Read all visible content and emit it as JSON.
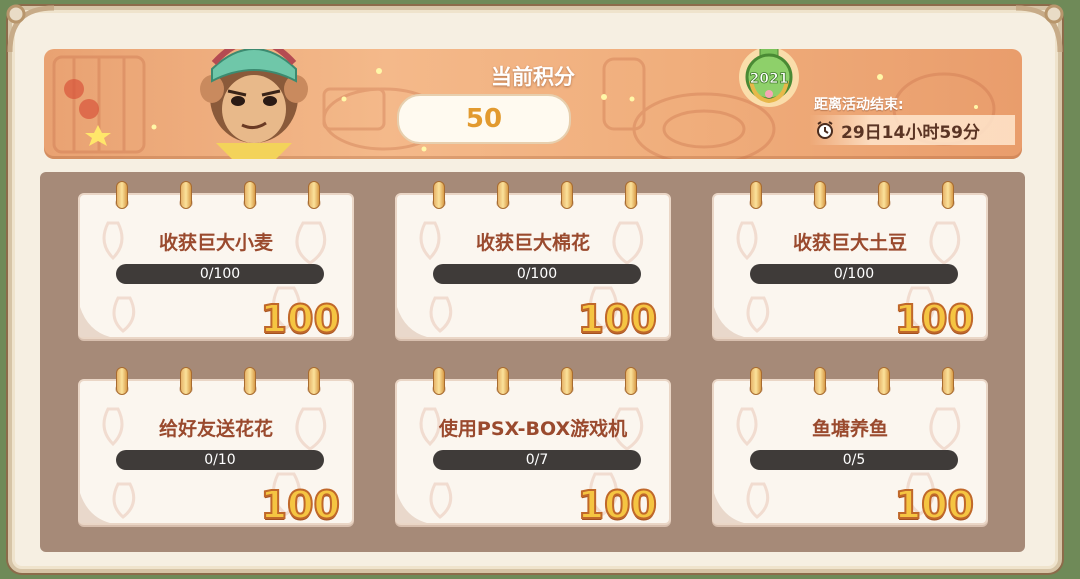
{
  "header": {
    "score_label": "当前积分",
    "score_value": "50",
    "badge_year": "2021",
    "ends_label": "距离活动结束:",
    "countdown": "29日14小时59分"
  },
  "tasks": [
    {
      "title": "收获巨大小麦",
      "progress": "0/100",
      "progress_fraction": 0,
      "reward": "100"
    },
    {
      "title": "收获巨大棉花",
      "progress": "0/100",
      "progress_fraction": 0,
      "reward": "100"
    },
    {
      "title": "收获巨大土豆",
      "progress": "0/100",
      "progress_fraction": 0,
      "reward": "100"
    },
    {
      "title": "给好友送花花",
      "progress": "0/10",
      "progress_fraction": 0,
      "reward": "100"
    },
    {
      "title": "使用PSX-BOX游戏机",
      "progress": "0/7",
      "progress_fraction": 0,
      "reward": "100"
    },
    {
      "title": "鱼塘养鱼",
      "progress": "0/5",
      "progress_fraction": 0,
      "reward": "100"
    }
  ],
  "icons": {
    "clock": "alarm-clock-icon",
    "badge": "laurel-medal-icon",
    "avatar": "monkey-character-avatar"
  },
  "colors": {
    "header_bg": "#f0ae7c",
    "panel_bg": "#a68a78",
    "title_text": "#9a4a2e",
    "reward_fill": "#f5c542",
    "score_text": "#e29a2f"
  }
}
